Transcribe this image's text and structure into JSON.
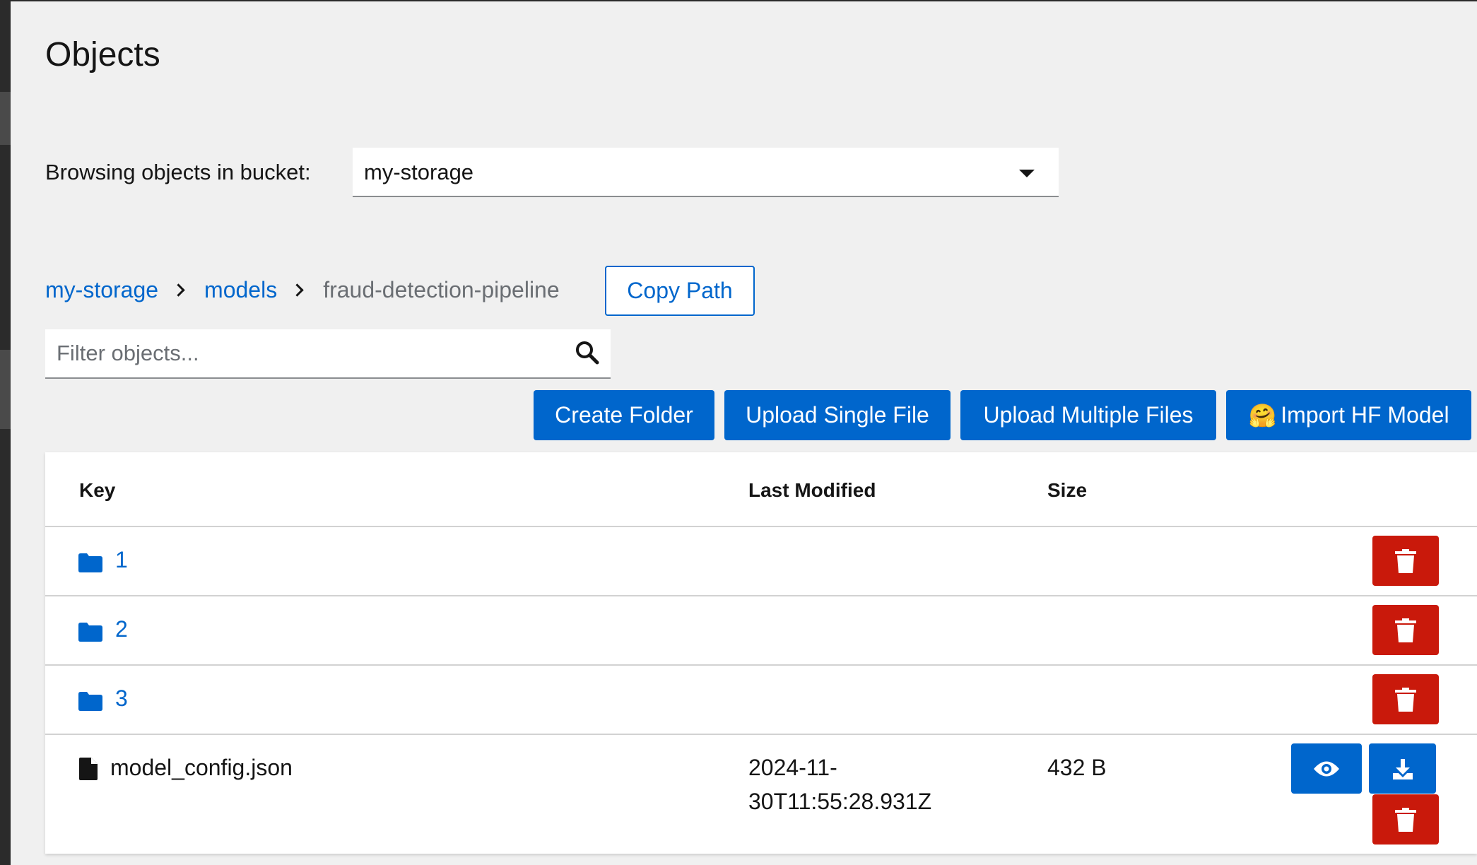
{
  "page": {
    "title": "Objects"
  },
  "bucket": {
    "label": "Browsing objects in bucket:",
    "selected": "my-storage"
  },
  "breadcrumb": {
    "items": [
      "my-storage",
      "models",
      "fraud-detection-pipeline"
    ]
  },
  "copy_path": {
    "label": "Copy Path"
  },
  "filter": {
    "placeholder": "Filter objects..."
  },
  "actions": {
    "create_folder": "Create Folder",
    "upload_single": "Upload Single File",
    "upload_multiple": "Upload Multiple Files",
    "import_hf": "Import HF Model",
    "import_hf_emoji": "🤗"
  },
  "table": {
    "columns": [
      "Key",
      "Last Modified",
      "Size"
    ],
    "rows": [
      {
        "type": "folder",
        "key": "1"
      },
      {
        "type": "folder",
        "key": "2"
      },
      {
        "type": "folder",
        "key": "3"
      },
      {
        "type": "file",
        "key": "model_config.json",
        "modified_line1": "2024-11-",
        "modified_line2": "30T11:55:28.931Z",
        "size": "432 B"
      }
    ]
  },
  "colors": {
    "primary": "#0066cc",
    "danger": "#c9190b"
  }
}
